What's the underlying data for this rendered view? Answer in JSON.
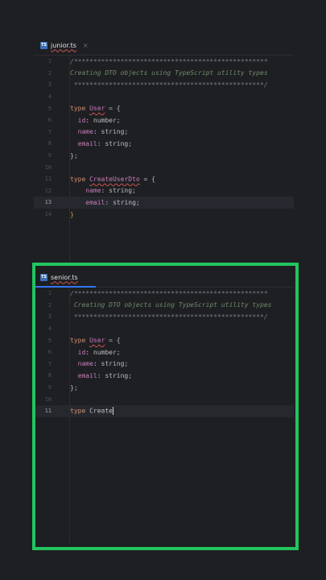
{
  "junior": {
    "tab_label": "junior.ts",
    "tab_icon": "TS",
    "close_glyph": "×",
    "lines": [
      {
        "n": "1",
        "segments": [
          {
            "t": "/**************************************************",
            "c": "stars"
          }
        ]
      },
      {
        "n": "2",
        "segments": [
          {
            "t": "Creating DTO objects using TypeScript utility types",
            "c": "comment"
          }
        ]
      },
      {
        "n": "3",
        "segments": [
          {
            "t": " *************************************************/",
            "c": "stars"
          }
        ]
      },
      {
        "n": "4",
        "segments": []
      },
      {
        "n": "5",
        "segments": [
          {
            "t": "type ",
            "c": "kw"
          },
          {
            "t": "User",
            "c": "warn"
          },
          {
            "t": " = {",
            "c": "punc"
          }
        ]
      },
      {
        "n": "6",
        "segments": [
          {
            "t": "  id",
            "c": "prop"
          },
          {
            "t": ": number;",
            "c": "punc"
          }
        ]
      },
      {
        "n": "7",
        "segments": [
          {
            "t": "  name",
            "c": "prop"
          },
          {
            "t": ": string;",
            "c": "punc"
          }
        ]
      },
      {
        "n": "8",
        "segments": [
          {
            "t": "  email",
            "c": "prop"
          },
          {
            "t": ": string;",
            "c": "punc"
          }
        ]
      },
      {
        "n": "9",
        "segments": [
          {
            "t": "};",
            "c": "punc"
          }
        ]
      },
      {
        "n": "10",
        "segments": []
      },
      {
        "n": "11",
        "segments": [
          {
            "t": "type ",
            "c": "kw"
          },
          {
            "t": "CreateUserDto",
            "c": "warn"
          },
          {
            "t": " = {",
            "c": "punc"
          }
        ]
      },
      {
        "n": "12",
        "segments": [
          {
            "t": "    name",
            "c": "prop"
          },
          {
            "t": ": string;",
            "c": "punc"
          }
        ]
      },
      {
        "n": "13",
        "segments": [
          {
            "t": "    email",
            "c": "prop"
          },
          {
            "t": ": string;",
            "c": "punc"
          }
        ],
        "current": true
      },
      {
        "n": "14",
        "segments": [
          {
            "t": "}",
            "c": "brace"
          }
        ]
      }
    ]
  },
  "senior": {
    "tab_label": "senior.ts",
    "tab_icon": "TS",
    "lines": [
      {
        "n": "1",
        "segments": [
          {
            "t": "/**************************************************",
            "c": "stars"
          }
        ]
      },
      {
        "n": "2",
        "segments": [
          {
            "t": " Creating DTO objects using TypeScript utility types",
            "c": "comment"
          }
        ]
      },
      {
        "n": "3",
        "segments": [
          {
            "t": " *************************************************/",
            "c": "stars"
          }
        ]
      },
      {
        "n": "4",
        "segments": []
      },
      {
        "n": "5",
        "segments": [
          {
            "t": "type ",
            "c": "kw"
          },
          {
            "t": "User",
            "c": "warn"
          },
          {
            "t": " = {",
            "c": "punc"
          }
        ]
      },
      {
        "n": "6",
        "segments": [
          {
            "t": "  id",
            "c": "prop"
          },
          {
            "t": ": number;",
            "c": "punc"
          }
        ]
      },
      {
        "n": "7",
        "segments": [
          {
            "t": "  name",
            "c": "prop"
          },
          {
            "t": ": string;",
            "c": "punc"
          }
        ]
      },
      {
        "n": "8",
        "segments": [
          {
            "t": "  email",
            "c": "prop"
          },
          {
            "t": ": string;",
            "c": "punc"
          }
        ]
      },
      {
        "n": "9",
        "segments": [
          {
            "t": "};",
            "c": "punc"
          }
        ]
      },
      {
        "n": "10",
        "segments": []
      },
      {
        "n": "11",
        "segments": [
          {
            "t": "type ",
            "c": "kw"
          },
          {
            "t": "Create",
            "c": "punc"
          }
        ],
        "current": true,
        "caret": true
      }
    ]
  },
  "colors": {
    "highlight_frame": "#22c55e",
    "tab_accent": "#3574f0"
  }
}
